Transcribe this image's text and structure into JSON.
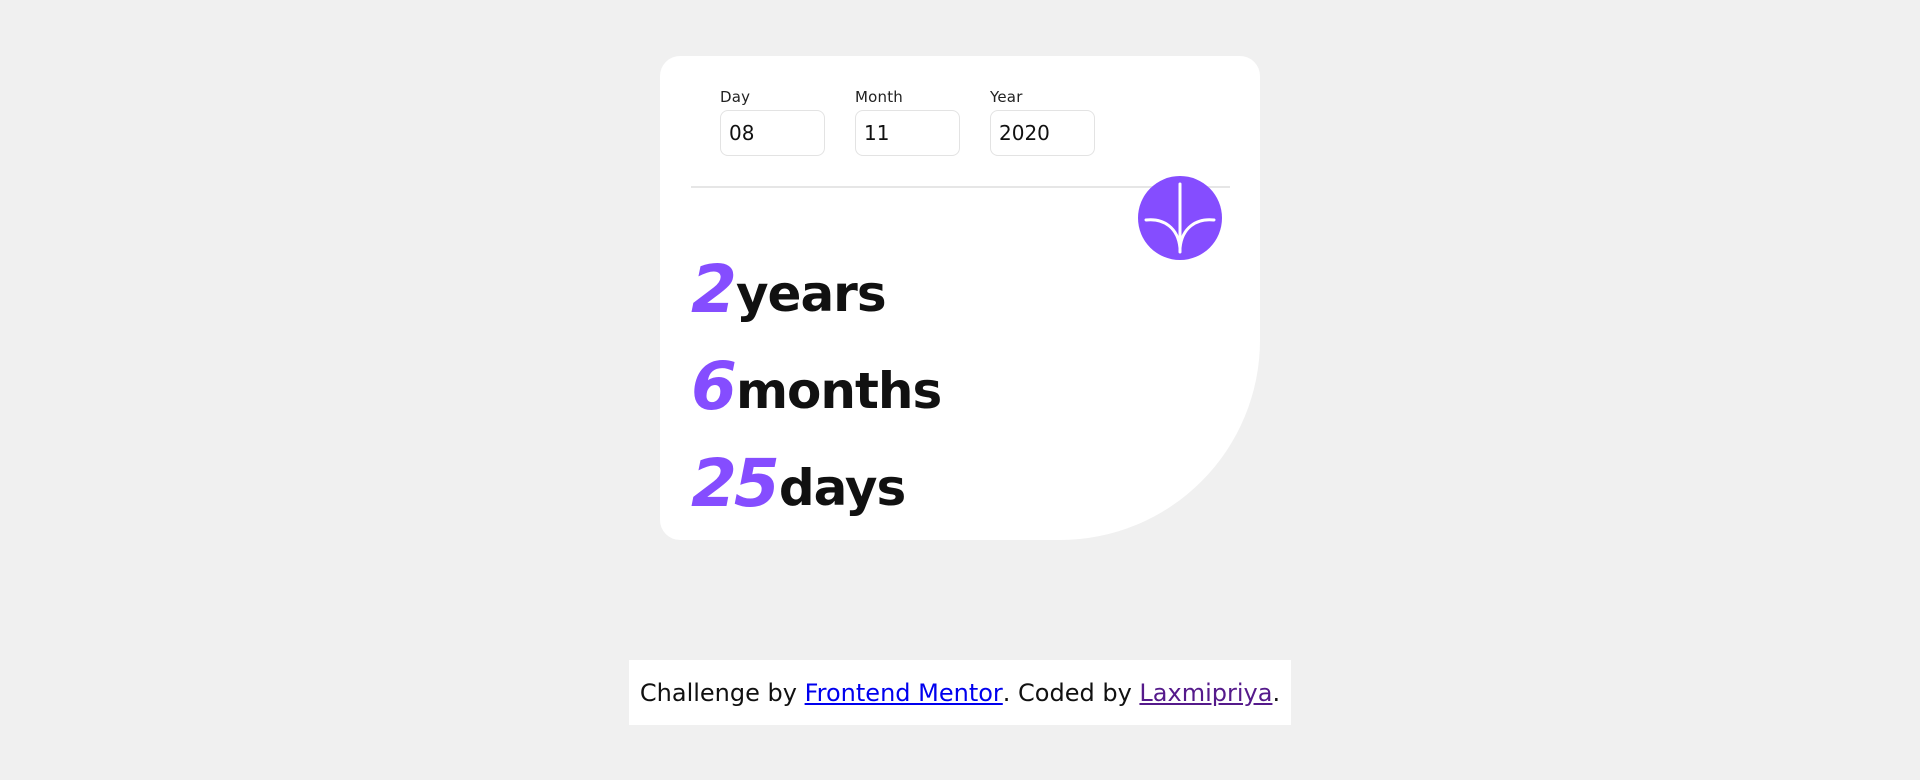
{
  "form": {
    "day": {
      "label": "Day",
      "value": "08"
    },
    "month": {
      "label": "Month",
      "value": "11"
    },
    "year": {
      "label": "Year",
      "value": "2020"
    }
  },
  "submit": {
    "icon": "arrow-down-icon",
    "color": "#854dff"
  },
  "results": [
    {
      "number": "2",
      "unit": "years"
    },
    {
      "number": "6",
      "unit": "months"
    },
    {
      "number": "25",
      "unit": "days"
    }
  ],
  "attribution": {
    "prefix": "Challenge by ",
    "link1": "Frontend Mentor",
    "middle": ". Coded by ",
    "link2": "Laxmipriya",
    "suffix": "."
  },
  "colors": {
    "accent": "#854dff",
    "background": "#f0f0f0",
    "card": "#ffffff"
  }
}
